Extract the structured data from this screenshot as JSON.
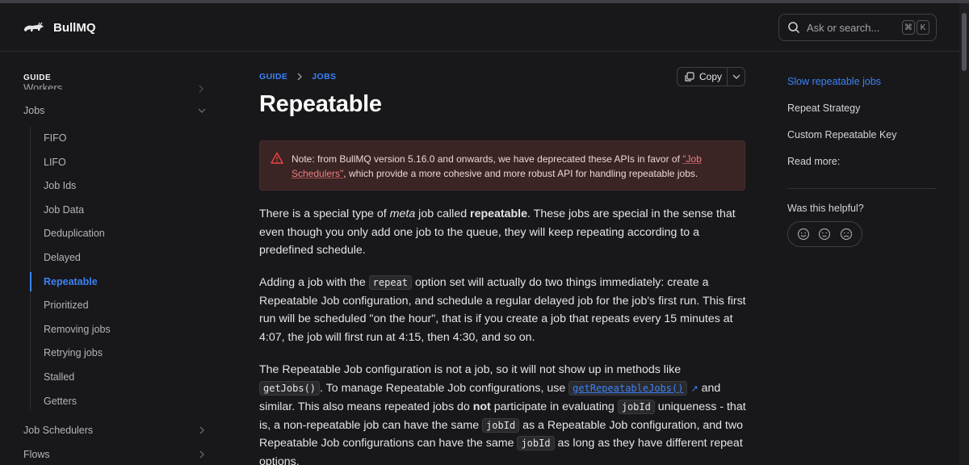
{
  "brand": {
    "name": "BullMQ"
  },
  "search": {
    "placeholder": "Ask or search...",
    "shortcut": [
      "⌘",
      "K"
    ]
  },
  "sidebar": {
    "section": "GUIDE",
    "partial_item": "Workers",
    "items_top": [
      {
        "label": "Jobs"
      }
    ],
    "sub_items": [
      "FIFO",
      "LIFO",
      "Job Ids",
      "Job Data",
      "Deduplication",
      "Delayed",
      "Repeatable",
      "Prioritized",
      "Removing jobs",
      "Retrying jobs",
      "Stalled",
      "Getters"
    ],
    "active_sub": "Repeatable",
    "items_bottom": [
      {
        "label": "Job Schedulers"
      },
      {
        "label": "Flows"
      }
    ]
  },
  "breadcrumb": {
    "items": [
      "GUIDE",
      "JOBS"
    ]
  },
  "copy_button": {
    "label": "Copy"
  },
  "page": {
    "title": "Repeatable",
    "warning": {
      "before": "Note: from BullMQ version 5.16.0 and onwards, we have deprecated these APIs in favor of ",
      "link": "\"Job Schedulers\"",
      "after": ", which provide a more cohesive and more robust API for handling repeatable jobs."
    },
    "p1": {
      "a": "There is a special type of ",
      "em": "meta",
      "b": " job called ",
      "strong": "repeatable",
      "c": ". These jobs are special in the sense that even though you only add one job to the queue, they will keep repeating according to a predefined schedule."
    },
    "p2": {
      "a": "Adding a job with the ",
      "code": "repeat",
      "b": " option set will actually do two things immediately: create a Repeatable Job configuration, and schedule a regular delayed job for the job's first run. This first run will be scheduled \"on the hour\", that is if you create a job that repeats every 15 minutes at 4:07, the job will first run at 4:15, then 4:30, and so on."
    },
    "p3": {
      "a": "The Repeatable Job configuration is not a job, so it will not show up in methods like ",
      "code1": "getJobs()",
      "b": ". To manage Repeatable Job configurations, use ",
      "link_code": "getRepeatableJobs()",
      "ext": "↗",
      "c": " and similar. This also means repeated jobs do ",
      "strong": "not",
      "d": " participate in evaluating ",
      "code2": "jobId",
      "e": " uniqueness - that is, a non-repeatable job can have the same ",
      "code3": "jobId",
      "f": " as a Repeatable Job configuration, and two Repeatable Job configurations can have the same ",
      "code4": "jobId",
      "g": " as long as they have different repeat options."
    }
  },
  "toc": {
    "items": [
      "Slow repeatable jobs",
      "Repeat Strategy",
      "Custom Repeatable Key",
      "Read more:"
    ],
    "active": "Slow repeatable jobs",
    "helpful_label": "Was this helpful?",
    "feedback_icons": [
      "happy-face-icon",
      "neutral-face-icon",
      "sad-face-icon"
    ]
  },
  "colors": {
    "accent": "#3b82f6",
    "warning_bg": "#3a2424",
    "warning_icon": "#ef4444",
    "background": "#18181b"
  }
}
